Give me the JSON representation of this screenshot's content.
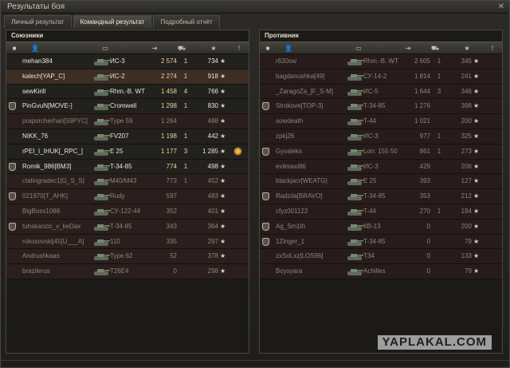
{
  "window": {
    "title": "Результаты боя",
    "close_icon": "close-icon"
  },
  "tabs": [
    {
      "label": "Личный результат",
      "active": false
    },
    {
      "label": "Командный результат",
      "active": true
    },
    {
      "label": "Подробный отчёт",
      "active": false
    }
  ],
  "allies": {
    "title": "Союзники",
    "rows": [
      {
        "name": "mehan384",
        "vehicle": "ИС-3",
        "damage": "2 574",
        "frags": "1",
        "xp": "734",
        "dead": false,
        "me": false,
        "medal": false,
        "badge": false
      },
      {
        "name": "kalech[YAP_C]",
        "vehicle": "ИС-2",
        "damage": "2 274",
        "frags": "1",
        "xp": "918",
        "dead": false,
        "me": true,
        "medal": false,
        "badge": false
      },
      {
        "name": "sewKirill",
        "vehicle": "Rhm.-B. WT",
        "damage": "1 458",
        "frags": "4",
        "xp": "766",
        "dead": false,
        "me": false,
        "medal": false,
        "badge": false
      },
      {
        "name": "PinGvuN[MOVE-]",
        "vehicle": "Cromwell",
        "damage": "1 298",
        "frags": "1",
        "xp": "830",
        "dead": false,
        "me": false,
        "medal": true,
        "badge": false
      },
      {
        "name": "praporcherhan[59PYC]",
        "vehicle": "Type 59",
        "damage": "1 264",
        "frags": "",
        "xp": "488",
        "dead": true,
        "me": false,
        "medal": false,
        "badge": false
      },
      {
        "name": "NIKK_76",
        "vehicle": "FV207",
        "damage": "1 198",
        "frags": "1",
        "xp": "442",
        "dead": false,
        "me": false,
        "medal": false,
        "badge": false
      },
      {
        "name": "rPEI_I_IHUK[_RPC_]",
        "vehicle": "E 25",
        "damage": "1 177",
        "frags": "3",
        "xp": "1 285",
        "dead": false,
        "me": false,
        "medal": false,
        "badge": true
      },
      {
        "name": "Romik_986[BM3]",
        "vehicle": "T-34-85",
        "damage": "774",
        "frags": "1",
        "xp": "498",
        "dead": false,
        "me": false,
        "medal": true,
        "badge": false
      },
      {
        "name": "ctalingradec1[G_S_S]",
        "vehicle": "M40/M43",
        "damage": "773",
        "frags": "1",
        "xp": "452",
        "dead": true,
        "me": false,
        "medal": false,
        "badge": false
      },
      {
        "name": "021970[T_AHK]",
        "vehicle": "Rudy",
        "damage": "597",
        "frags": "",
        "xp": "483",
        "dead": true,
        "me": false,
        "medal": true,
        "badge": false
      },
      {
        "name": "BigBoss1088",
        "vehicle": "СУ-122-44",
        "damage": "352",
        "frags": "",
        "xp": "401",
        "dead": true,
        "me": false,
        "medal": false,
        "badge": false
      },
      {
        "name": "tuhskanzic_v_keDax",
        "vehicle": "T-34-85",
        "damage": "343",
        "frags": "",
        "xp": "364",
        "dead": true,
        "me": false,
        "medal": true,
        "badge": false
      },
      {
        "name": "rokosovskij45[U___A]",
        "vehicle": "110",
        "damage": "335",
        "frags": "",
        "xp": "297",
        "dead": true,
        "me": false,
        "medal": false,
        "badge": false
      },
      {
        "name": "Andrushkaas",
        "vehicle": "Type 62",
        "damage": "52",
        "frags": "",
        "xp": "378",
        "dead": true,
        "me": false,
        "medal": false,
        "badge": false
      },
      {
        "name": "brazilerus",
        "vehicle": "T26E4",
        "damage": "0",
        "frags": "",
        "xp": "298",
        "dead": true,
        "me": false,
        "medal": false,
        "badge": false
      }
    ]
  },
  "enemies": {
    "title": "Противник",
    "rows": [
      {
        "name": "r630ow",
        "vehicle": "Rhm.-B. WT",
        "damage": "2 605",
        "frags": "1",
        "xp": "345",
        "dead": true,
        "medal": false
      },
      {
        "name": "bagdanushka[49]",
        "vehicle": "СУ-14-2",
        "damage": "1 814",
        "frags": "1",
        "xp": "241",
        "dead": true,
        "medal": false
      },
      {
        "name": "_ZaragoZa_[F_S-M]",
        "vehicle": "ИС-5",
        "damage": "1 644",
        "frags": "3",
        "xp": "346",
        "dead": true,
        "medal": false
      },
      {
        "name": "Strokove[TOP-3]",
        "vehicle": "T-34-85",
        "damage": "1 276",
        "frags": "",
        "xp": "398",
        "dead": true,
        "medal": true
      },
      {
        "name": "sowdeath",
        "vehicle": "T-44",
        "damage": "1 021",
        "frags": "",
        "xp": "200",
        "dead": true,
        "medal": false
      },
      {
        "name": "zpkj26",
        "vehicle": "ИС-3",
        "damage": "977",
        "frags": "1",
        "xp": "325",
        "dead": true,
        "medal": false
      },
      {
        "name": "Gyvaleks",
        "vehicle": "Lorr. 155 50",
        "damage": "861",
        "frags": "1",
        "xp": "273",
        "dead": true,
        "medal": true
      },
      {
        "name": "evilmaxi86",
        "vehicle": "ИС-3",
        "damage": "429",
        "frags": "",
        "xp": "206",
        "dead": true,
        "medal": false
      },
      {
        "name": "blackjacr[WEATG]",
        "vehicle": "E 25",
        "damage": "393",
        "frags": "",
        "xp": "127",
        "dead": true,
        "medal": false
      },
      {
        "name": "Radzila[BRAVO]",
        "vehicle": "T-34-85",
        "damage": "353",
        "frags": "",
        "xp": "212",
        "dead": true,
        "medal": true
      },
      {
        "name": "cfyz001122",
        "vehicle": "T-44",
        "damage": "270",
        "frags": "1",
        "xp": "194",
        "dead": true,
        "medal": false
      },
      {
        "name": "Ag_Sm1th",
        "vehicle": "КВ-13",
        "damage": "0",
        "frags": "",
        "xp": "200",
        "dead": true,
        "medal": true
      },
      {
        "name": "1Zinger_1",
        "vehicle": "T-34-85",
        "damage": "0",
        "frags": "",
        "xp": "79",
        "dead": true,
        "medal": true
      },
      {
        "name": "zxSoLxz[LOS96]",
        "vehicle": "T34",
        "damage": "0",
        "frags": "",
        "xp": "133",
        "dead": true,
        "medal": false
      },
      {
        "name": "Boysyara",
        "vehicle": "Achilles",
        "damage": "0",
        "frags": "",
        "xp": "79",
        "dead": true,
        "medal": false
      }
    ]
  },
  "watermark": "YAPLAKAL.COM",
  "colors": {
    "damage": "#e8d39a",
    "dead_text": "#8b857a",
    "enemy_row": "#2d1e1d",
    "my_row": "#3c2d25"
  }
}
